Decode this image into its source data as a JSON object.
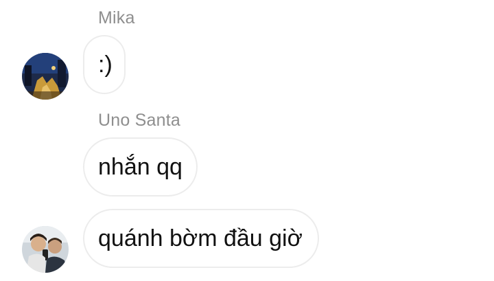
{
  "messages": [
    {
      "sender": "Mika",
      "text": ":)",
      "avatar": "user-photo-night-street"
    },
    {
      "sender": "Uno Santa",
      "text": "nhắn qq",
      "avatar": null
    },
    {
      "sender": "Uno Santa",
      "text": "quánh bờm đầu giờ",
      "avatar": "user-photo-selfie"
    }
  ]
}
